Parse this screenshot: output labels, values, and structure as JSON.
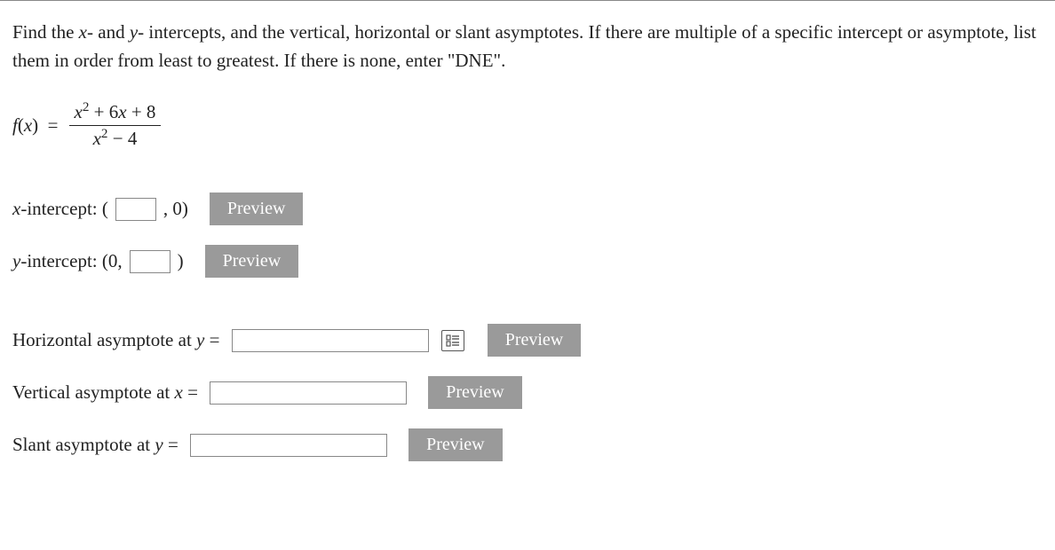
{
  "prompt_text": "Find the x- and y- intercepts, and the vertical, horizontal or slant asymptotes. If there are multiple of a specific intercept or asymptote, list them in order from least to greatest. If there is none, enter \"DNE\".",
  "function": {
    "lhs_prefix": "f(x) =",
    "numerator": "x² + 6x + 8",
    "denominator": "x² − 4"
  },
  "fields": {
    "x_intercept": {
      "prefix": "x-intercept: (",
      "suffix": " , 0)",
      "value": ""
    },
    "y_intercept": {
      "prefix": "y-intercept: (0, ",
      "suffix": " )",
      "value": ""
    },
    "horizontal": {
      "label": "Horizontal asymptote at y = ",
      "value": ""
    },
    "vertical": {
      "label": "Vertical asymptote at x = ",
      "value": ""
    },
    "slant": {
      "label": "Slant asymptote at y = ",
      "value": ""
    }
  },
  "buttons": {
    "preview": "Preview"
  }
}
